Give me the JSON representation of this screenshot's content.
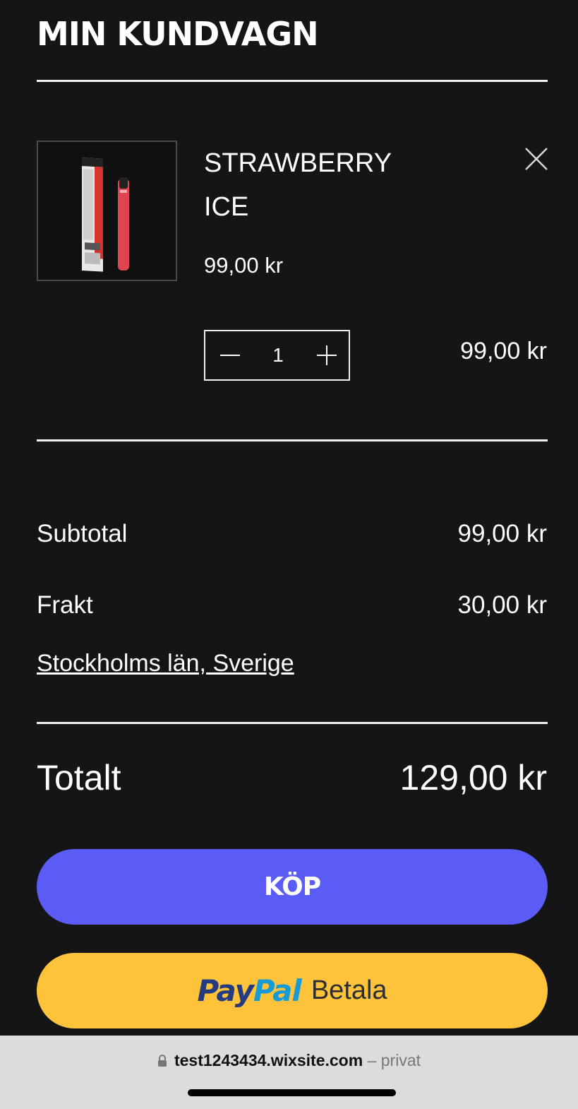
{
  "cart": {
    "title": "MIN KUNDVAGN",
    "item": {
      "name": "STRAWBERRY ICE",
      "unit_price": "99,00 kr",
      "quantity": "1",
      "line_total": "99,00 kr",
      "image_icon": "vape-product-image"
    },
    "summary": {
      "subtotal_label": "Subtotal",
      "subtotal_value": "99,00 kr",
      "shipping_label": "Frakt",
      "shipping_value": "30,00 kr",
      "region_link": "Stockholms län, Sverige",
      "total_label": "Totalt",
      "total_value": "129,00 kr"
    },
    "buy_button": "KÖP",
    "paypal": {
      "brand_pay": "Pay",
      "brand_pal": "Pal",
      "label": "Betala"
    }
  },
  "browser": {
    "domain": "test1243434.wixsite.com",
    "mode": "– privat"
  },
  "colors": {
    "background": "#151517",
    "buy_button": "#5b5cf6",
    "paypal_button": "#fec33a"
  }
}
